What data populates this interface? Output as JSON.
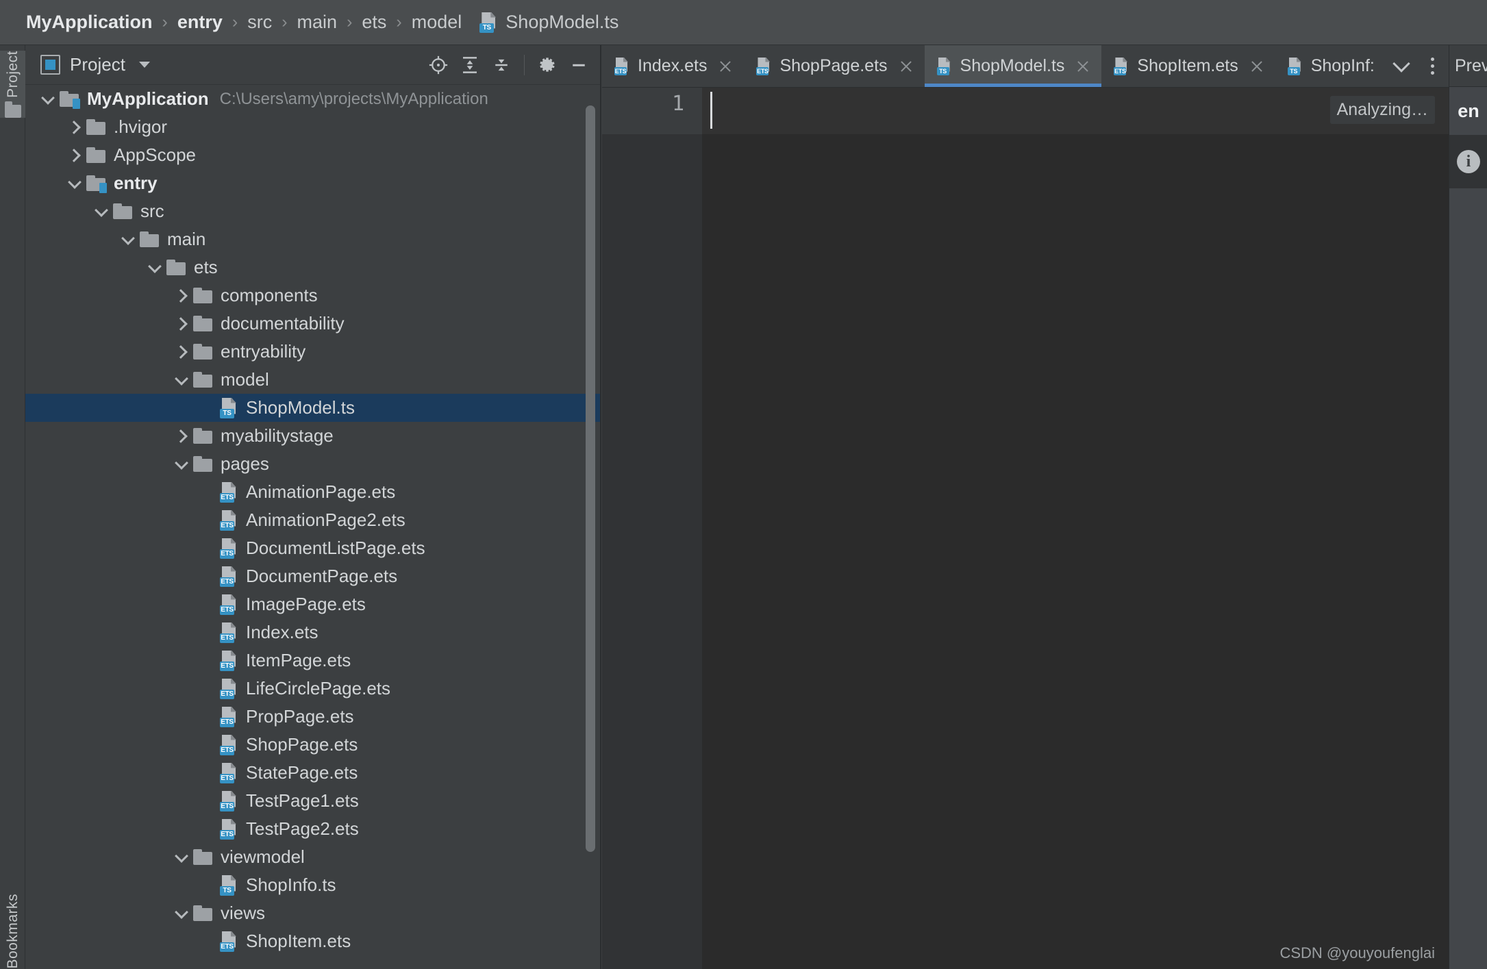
{
  "breadcrumb": {
    "segments": [
      "MyApplication",
      "entry",
      "src",
      "main",
      "ets",
      "model"
    ],
    "separator": "›",
    "file": "ShopModel.ts",
    "file_badge": "TS"
  },
  "left_strip": {
    "project_tab": "Project",
    "bookmarks_tab": "Bookmarks"
  },
  "project_panel": {
    "title": "Project",
    "toolbar": {
      "locate_icon": "locate-target-icon",
      "expand_all_icon": "expand-all-icon",
      "collapse_all_icon": "collapse-all-icon",
      "settings_icon": "gear-icon",
      "hide_icon": "minimize-icon"
    },
    "tree": [
      {
        "label": "MyApplication",
        "path": "C:\\Users\\amy\\projects\\MyApplication",
        "depth": 0,
        "arrow": "down",
        "icon": "module",
        "bold": true
      },
      {
        "label": ".hvigor",
        "depth": 1,
        "arrow": "right",
        "icon": "folder"
      },
      {
        "label": "AppScope",
        "depth": 1,
        "arrow": "right",
        "icon": "folder"
      },
      {
        "label": "entry",
        "depth": 1,
        "arrow": "down",
        "icon": "module",
        "bold": true
      },
      {
        "label": "src",
        "depth": 2,
        "arrow": "down",
        "icon": "folder"
      },
      {
        "label": "main",
        "depth": 3,
        "arrow": "down",
        "icon": "folder"
      },
      {
        "label": "ets",
        "depth": 4,
        "arrow": "down",
        "icon": "folder"
      },
      {
        "label": "components",
        "depth": 5,
        "arrow": "right",
        "icon": "folder"
      },
      {
        "label": "documentability",
        "depth": 5,
        "arrow": "right",
        "icon": "folder"
      },
      {
        "label": "entryability",
        "depth": 5,
        "arrow": "right",
        "icon": "folder"
      },
      {
        "label": "model",
        "depth": 5,
        "arrow": "down",
        "icon": "folder"
      },
      {
        "label": "ShopModel.ts",
        "depth": 6,
        "arrow": "none",
        "icon": "file",
        "badge": "TS",
        "selected": true
      },
      {
        "label": "myabilitystage",
        "depth": 5,
        "arrow": "right",
        "icon": "folder"
      },
      {
        "label": "pages",
        "depth": 5,
        "arrow": "down",
        "icon": "folder"
      },
      {
        "label": "AnimationPage.ets",
        "depth": 6,
        "arrow": "none",
        "icon": "file",
        "badge": "ETS"
      },
      {
        "label": "AnimationPage2.ets",
        "depth": 6,
        "arrow": "none",
        "icon": "file",
        "badge": "ETS"
      },
      {
        "label": "DocumentListPage.ets",
        "depth": 6,
        "arrow": "none",
        "icon": "file",
        "badge": "ETS"
      },
      {
        "label": "DocumentPage.ets",
        "depth": 6,
        "arrow": "none",
        "icon": "file",
        "badge": "ETS"
      },
      {
        "label": "ImagePage.ets",
        "depth": 6,
        "arrow": "none",
        "icon": "file",
        "badge": "ETS"
      },
      {
        "label": "Index.ets",
        "depth": 6,
        "arrow": "none",
        "icon": "file",
        "badge": "ETS"
      },
      {
        "label": "ItemPage.ets",
        "depth": 6,
        "arrow": "none",
        "icon": "file",
        "badge": "ETS"
      },
      {
        "label": "LifeCirclePage.ets",
        "depth": 6,
        "arrow": "none",
        "icon": "file",
        "badge": "ETS"
      },
      {
        "label": "PropPage.ets",
        "depth": 6,
        "arrow": "none",
        "icon": "file",
        "badge": "ETS"
      },
      {
        "label": "ShopPage.ets",
        "depth": 6,
        "arrow": "none",
        "icon": "file",
        "badge": "ETS"
      },
      {
        "label": "StatePage.ets",
        "depth": 6,
        "arrow": "none",
        "icon": "file",
        "badge": "ETS"
      },
      {
        "label": "TestPage1.ets",
        "depth": 6,
        "arrow": "none",
        "icon": "file",
        "badge": "ETS"
      },
      {
        "label": "TestPage2.ets",
        "depth": 6,
        "arrow": "none",
        "icon": "file",
        "badge": "ETS"
      },
      {
        "label": "viewmodel",
        "depth": 5,
        "arrow": "down",
        "icon": "folder"
      },
      {
        "label": "ShopInfo.ts",
        "depth": 6,
        "arrow": "none",
        "icon": "file",
        "badge": "TS"
      },
      {
        "label": "views",
        "depth": 5,
        "arrow": "down",
        "icon": "folder"
      },
      {
        "label": "ShopItem.ets",
        "depth": 6,
        "arrow": "none",
        "icon": "file",
        "badge": "ETS"
      }
    ]
  },
  "editor": {
    "tabs": [
      {
        "label": "Index.ets",
        "badge": "ETS",
        "active": false,
        "closable": true
      },
      {
        "label": "ShopPage.ets",
        "badge": "ETS",
        "active": false,
        "closable": true
      },
      {
        "label": "ShopModel.ts",
        "badge": "TS",
        "active": true,
        "closable": true
      },
      {
        "label": "ShopItem.ets",
        "badge": "ETS",
        "active": false,
        "closable": true
      },
      {
        "label": "ShopInf:",
        "badge": "TS",
        "active": false,
        "closable": false
      }
    ],
    "tab_overflow_chevron": "chevron-down-icon",
    "tab_options_kebab": "more-options-icon",
    "line_number": "1",
    "code_line_1": "",
    "status_hint": "Analyzing…",
    "watermark": "CSDN @youyoufenglai"
  },
  "right_strip": {
    "preview_tab": "Prev",
    "locale_badge": "en",
    "info_icon_label": "i"
  }
}
